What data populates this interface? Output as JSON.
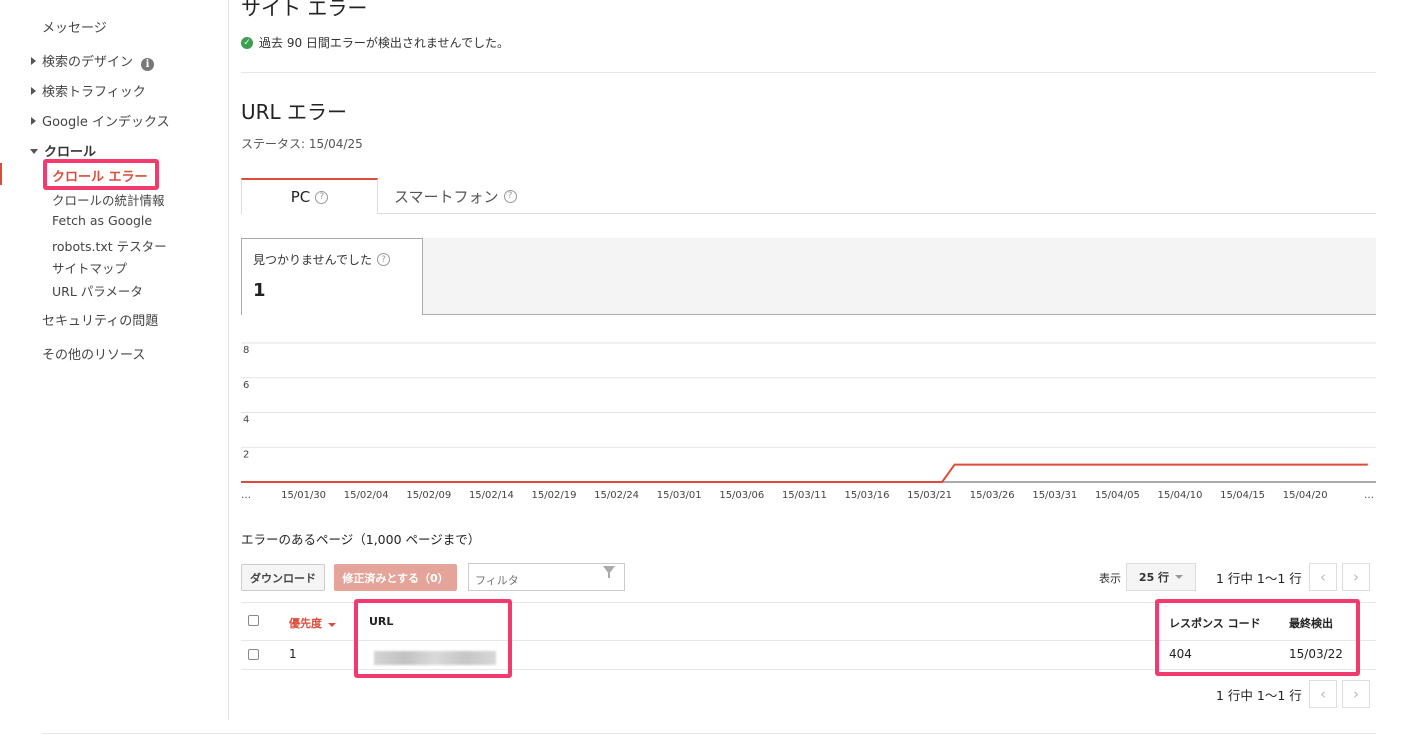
{
  "sidebar": {
    "messages": "メッセージ",
    "search_design": "検索のデザイン",
    "search_traffic": "検索トラフィック",
    "google_index": "Google インデックス",
    "crawl": "クロール",
    "crawl_items": [
      "クロール エラー",
      "クロールの統計情報",
      "Fetch as Google",
      "robots.txt テスター",
      "サイトマップ",
      "URL パラメータ"
    ],
    "security": "セキュリティの問題",
    "other": "その他のリソース"
  },
  "site_errors": {
    "title": "サイト エラー",
    "message": "過去 90 日間エラーが検出されませんでした。"
  },
  "url_errors": {
    "title": "URL エラー",
    "status": "ステータス: 15/04/25",
    "tabs": [
      "PC",
      "スマートフォン"
    ],
    "metric_label": "見つかりませんでした",
    "metric_value": "1"
  },
  "chart_data": {
    "type": "line",
    "x": [
      "…",
      "15/01/30",
      "15/02/04",
      "15/02/09",
      "15/02/14",
      "15/02/19",
      "15/02/24",
      "15/03/01",
      "15/03/06",
      "15/03/11",
      "15/03/16",
      "15/03/21",
      "15/03/26",
      "15/03/31",
      "15/04/05",
      "15/04/10",
      "15/04/15",
      "15/04/20",
      "…"
    ],
    "yticks": [
      "8",
      "6",
      "4",
      "2"
    ],
    "ylim": [
      0,
      8
    ],
    "series_color": "#dd4b39",
    "series": [
      {
        "points": [
          [
            "15/01/25",
            0
          ],
          [
            "15/03/22",
            0
          ],
          [
            "15/03/23",
            1
          ],
          [
            "15/04/25",
            1
          ]
        ]
      }
    ]
  },
  "pages": {
    "title": "エラーのあるページ（1,000 ページまで）",
    "download": "ダウンロード",
    "mark_fixed": "修正済みとする（0）",
    "filter_placeholder": "フィルタ",
    "show_label": "表示",
    "rows": "25 行",
    "range": "1 行中 1〜1 行",
    "prev_icon": "‹",
    "next_icon": "›",
    "columns": {
      "priority": "優先度",
      "url": "URL",
      "response": "レスポンス コード",
      "detected": "最終検出"
    },
    "row": {
      "priority": "1",
      "response": "404",
      "detected": "15/03/22"
    }
  }
}
